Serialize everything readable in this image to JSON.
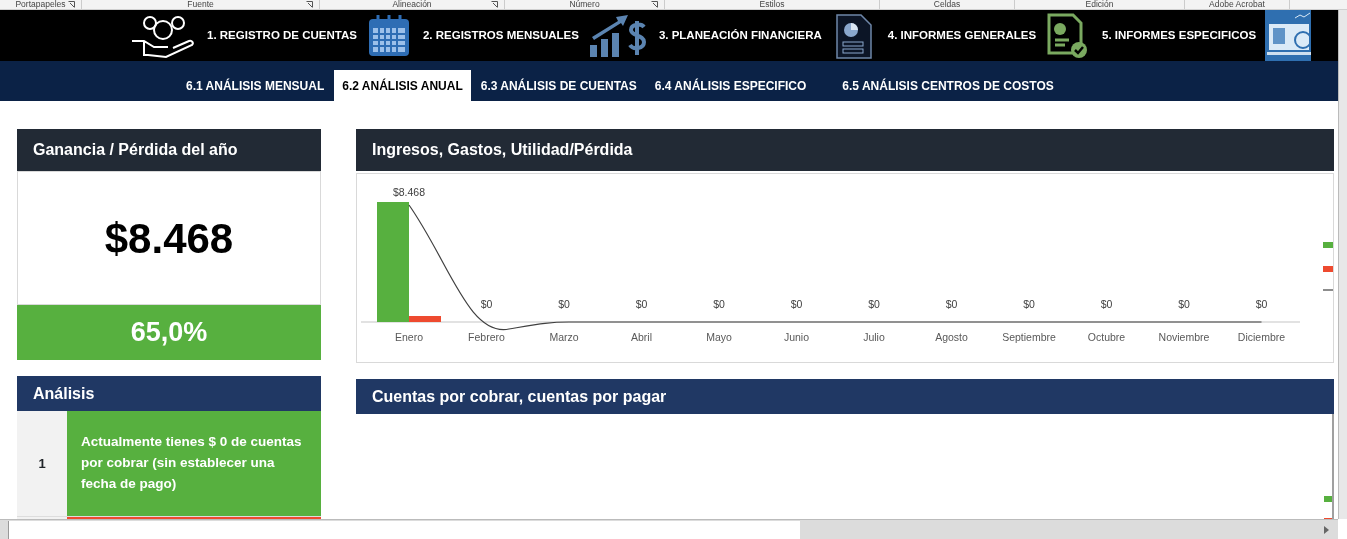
{
  "ribbon_groups": [
    {
      "label": "Portapapeles",
      "launcher": true
    },
    {
      "label": "Fuente",
      "launcher": true
    },
    {
      "label": "Alineación",
      "launcher": true
    },
    {
      "label": "Número",
      "launcher": true
    },
    {
      "label": "Estilos",
      "launcher": false
    },
    {
      "label": "Celdas",
      "launcher": false
    },
    {
      "label": "Edición",
      "launcher": false
    },
    {
      "label": "Adobe Acrobat",
      "launcher": false
    }
  ],
  "main_nav": [
    {
      "label": "1. REGISTRO DE CUENTAS"
    },
    {
      "label": "2. REGISTROS MENSUALES"
    },
    {
      "label": "3. PLANEACIÓN FINANCIERA"
    },
    {
      "label": "4. INFORMES GENERALES"
    },
    {
      "label": "5. INFORMES ESPECIFICOS"
    }
  ],
  "tabs": [
    {
      "label": "6.1 ANÁLISIS MENSUAL",
      "selected": false
    },
    {
      "label": "6.2 ANÁLISIS ANUAL",
      "selected": true
    },
    {
      "label": "6.3 ANÁLISIS DE CUENTAS",
      "selected": false
    },
    {
      "label": "6.4 ANÁLISIS ESPECIFICO",
      "selected": false
    },
    {
      "label": "6.5 ANÁLISIS CENTROS DE COSTOS",
      "selected": false
    }
  ],
  "profit_panel": {
    "title": "Ganancia / Pérdida del año",
    "amount": "$8.468",
    "percentage": "65,0%"
  },
  "analysis_panel": {
    "title": "Análisis",
    "rows": [
      {
        "number": "1",
        "text": "Actualmente tienes $ 0 de cuentas por cobrar (sin establecer una fecha de pago)",
        "color": "#57b03f"
      },
      {
        "color": "#ee4a2f"
      }
    ]
  },
  "chart_panel": {
    "title": "Ingresos, Gastos, Utilidad/Pérdida",
    "months": [
      "Enero",
      "Febrero",
      "Marzo",
      "Abril",
      "Mayo",
      "Junio",
      "Julio",
      "Agosto",
      "Septiembre",
      "Octubre",
      "Noviembre",
      "Diciembre"
    ],
    "value_labels": [
      "$8.468",
      "$0",
      "$0",
      "$0",
      "$0",
      "$0",
      "$0",
      "$0",
      "$0",
      "$0",
      "$0",
      "$0"
    ]
  },
  "receivables_panel": {
    "title": "Cuentas por cobrar, cuentas por pagar"
  }
}
